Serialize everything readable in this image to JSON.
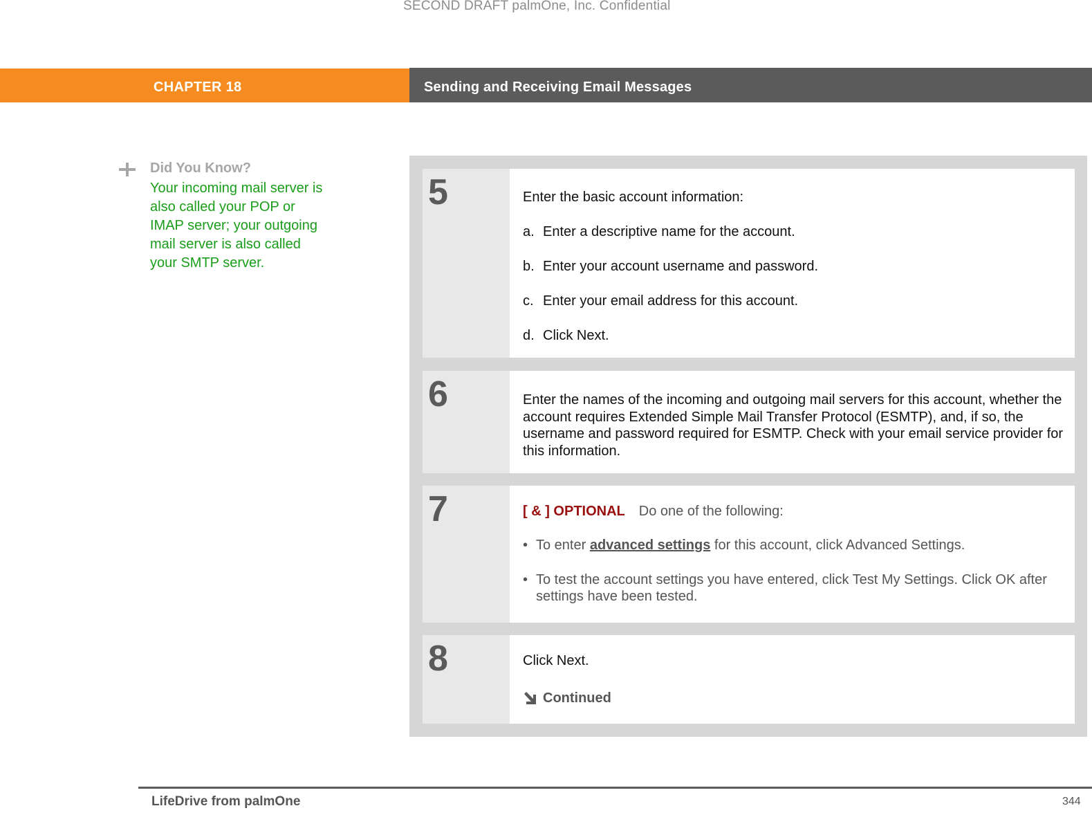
{
  "watermark": "SECOND DRAFT palmOne, Inc.  Confidential",
  "header": {
    "chapter": "CHAPTER 18",
    "title": "Sending and Receiving Email Messages",
    "colors": {
      "chapter_bg": "#f68b1f",
      "title_bg": "#5b5b5b"
    }
  },
  "sidebar": {
    "icon": "plus-icon",
    "title": "Did You Know?",
    "body": "Your incoming mail server is also called your POP or IMAP server; your outgoing mail server is also called your SMTP server.",
    "body_color": "#1a9d1a"
  },
  "steps": [
    {
      "number": "5",
      "intro": "Enter the basic account information:",
      "items": [
        {
          "label": "a.",
          "text": "Enter a descriptive name for the account."
        },
        {
          "label": "b.",
          "text": "Enter your account username and password."
        },
        {
          "label": "c.",
          "text": "Enter your email address for this account."
        },
        {
          "label": "d.",
          "text": "Click Next."
        }
      ]
    },
    {
      "number": "6",
      "text": "Enter the names of the incoming and outgoing mail servers for this account, whether the account requires Extended Simple Mail Transfer Protocol (ESMTP), and, if so, the username and password required for ESMTP. Check with your email service provider for this information."
    },
    {
      "number": "7",
      "tag": "[ & ]  OPTIONAL",
      "intro": "Do one of the following:",
      "bullets": [
        {
          "prefix": "To enter ",
          "link": "advanced settings",
          "suffix": " for this account, click Advanced Settings."
        },
        {
          "text": "To test the account settings you have entered, click Test My Settings. Click OK after settings have been tested."
        }
      ],
      "tag_color": "#9a0e0e"
    },
    {
      "number": "8",
      "text": "Click Next.",
      "continued_icon": "arrow-down-right-icon",
      "continued": "Continued"
    }
  ],
  "footer": {
    "title": "LifeDrive from palmOne",
    "page": "344"
  }
}
